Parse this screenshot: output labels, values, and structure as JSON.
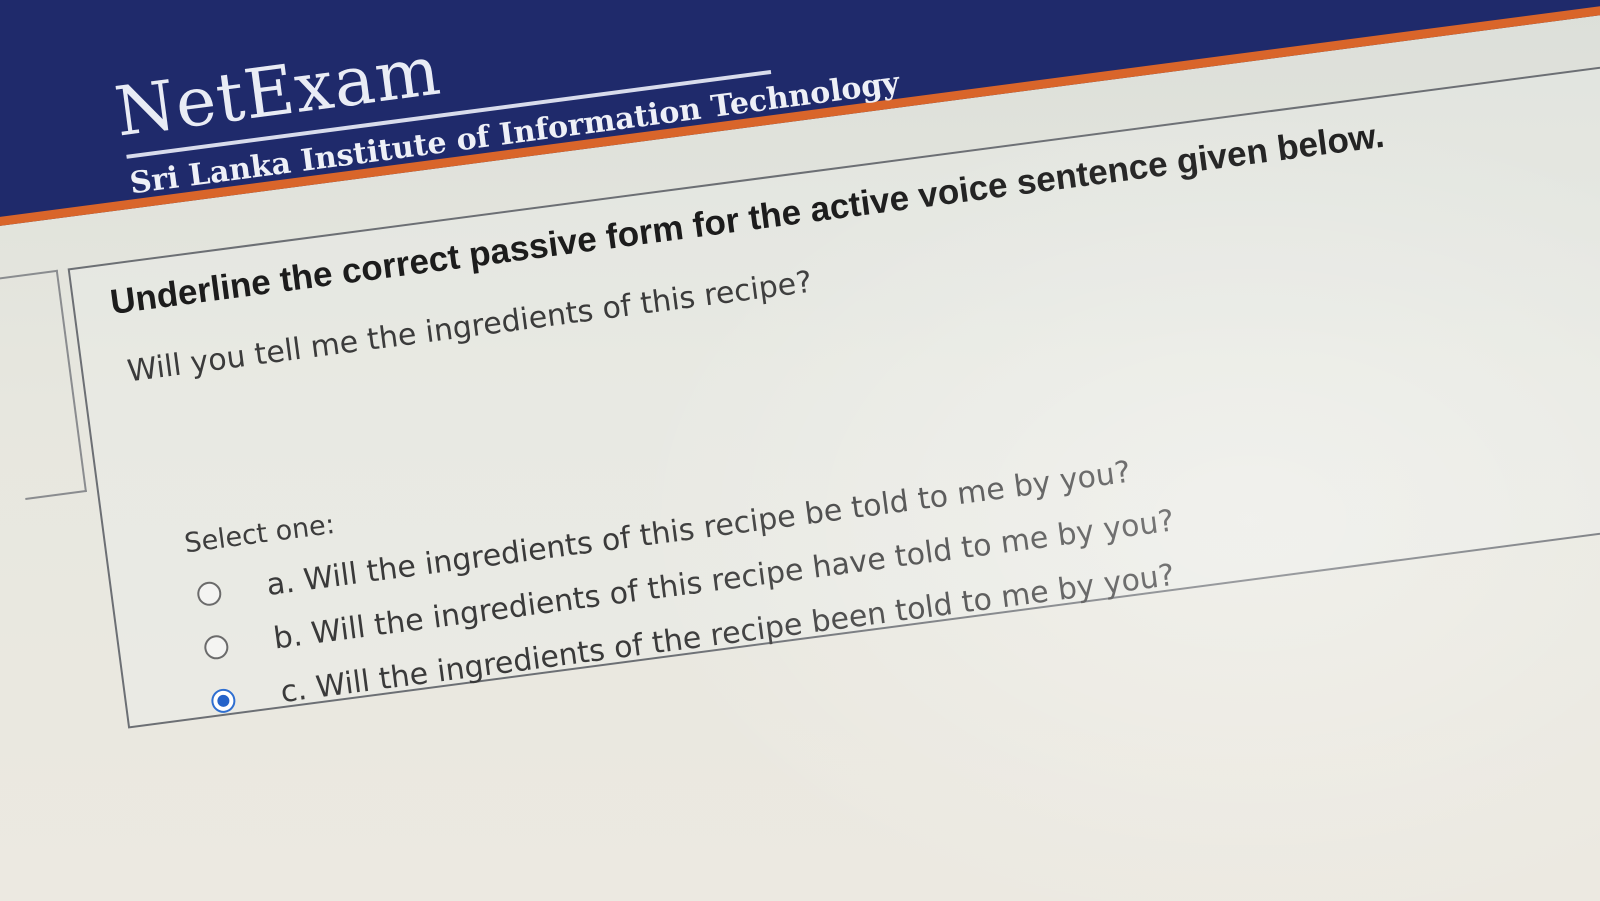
{
  "brand": {
    "name": "NetExam",
    "subtitle": "Sri Lanka Institute of Information Technology"
  },
  "question": {
    "instruction": "Underline the correct passive form for the active voice sentence given below.",
    "sentence": "Will you tell me the ingredients of this recipe?",
    "select_label": "Select one:",
    "options": [
      {
        "label": "a. Will the ingredients of this recipe be told to me by you?",
        "selected": false
      },
      {
        "label": "b. Will the ingredients of this recipe have told to me by you?",
        "selected": false
      },
      {
        "label": "c. Will the ingredients of the recipe been told to me by you?",
        "selected": true
      }
    ]
  },
  "colors": {
    "header_bg": "#1f2a6b",
    "header_accent": "#d9652a",
    "radio_selected": "#2563c9"
  }
}
